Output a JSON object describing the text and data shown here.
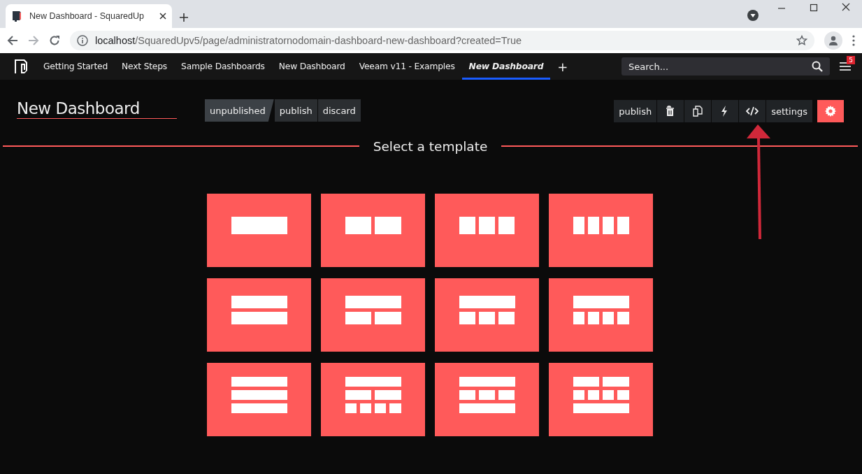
{
  "browser": {
    "tab_title": "New Dashboard - SquaredUp",
    "url_host": "localhost",
    "url_path": "/SquaredUpv5/page/administratornodomain-dashboard-new-dashboard?created=True"
  },
  "nav": {
    "items": [
      {
        "label": "Getting Started",
        "selected": false
      },
      {
        "label": "Next Steps",
        "selected": false
      },
      {
        "label": "Sample Dashboards",
        "selected": false
      },
      {
        "label": "New Dashboard",
        "selected": false
      },
      {
        "label": "Veeam v11 - Examples",
        "selected": false
      },
      {
        "label": "New Dashboard",
        "selected": true
      }
    ],
    "add": "+",
    "search": {
      "placeholder": "Search..."
    },
    "notification_count": "5"
  },
  "dashboard": {
    "title": "New Dashboard",
    "status": [
      {
        "label": "unpublished",
        "selected": true
      },
      {
        "label": "publish",
        "selected": false
      },
      {
        "label": "discard",
        "selected": false
      }
    ],
    "toolbar": [
      {
        "kind": "text",
        "label": "publish"
      },
      {
        "kind": "delete"
      },
      {
        "kind": "copy"
      },
      {
        "kind": "lightning"
      },
      {
        "kind": "code"
      },
      {
        "kind": "text",
        "label": "settings"
      },
      {
        "kind": "gear"
      }
    ]
  },
  "template_heading": "Select a template",
  "templates": [
    {
      "kind": "single"
    },
    {
      "kind": "halves"
    },
    {
      "kind": "thirds"
    },
    {
      "kind": "quarters"
    },
    {
      "kind": "stacked"
    },
    {
      "kind": "top-halves"
    },
    {
      "kind": "top-thirds"
    },
    {
      "kind": "top-quarters"
    },
    {
      "kind": "triple-stacked"
    },
    {
      "kind": "top-halves-quarters"
    },
    {
      "kind": "top-thirds-bottom"
    },
    {
      "kind": "halves-quarters-bottom"
    }
  ]
}
